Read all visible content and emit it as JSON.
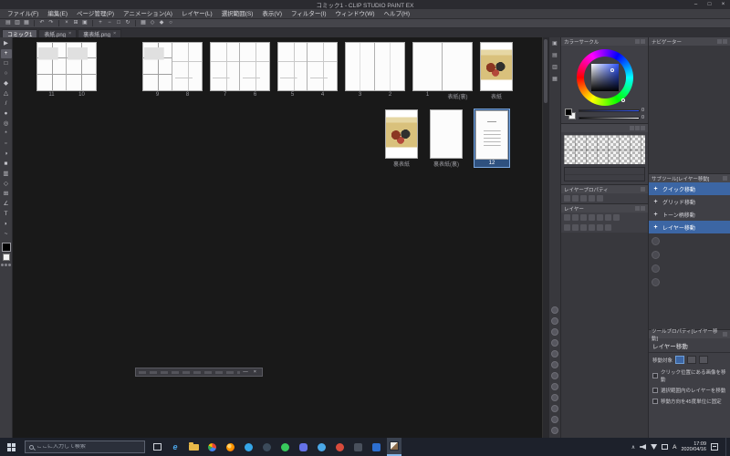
{
  "window": {
    "title": "コミック1 - CLIP STUDIO PAINT EX",
    "minimize": "–",
    "maximize": "□",
    "close": "×"
  },
  "menu": {
    "items": [
      "ファイル(F)",
      "編集(E)",
      "ページ管理(P)",
      "アニメーション(A)",
      "レイヤー(L)",
      "選択範囲(S)",
      "表示(V)",
      "フィルター(I)",
      "ウィンドウ(W)",
      "ヘルプ(H)"
    ]
  },
  "command_bar": {
    "icons": [
      {
        "name": "new-icon",
        "glyph": "▤"
      },
      {
        "name": "open-icon",
        "glyph": "▥"
      },
      {
        "name": "save-icon",
        "glyph": "▦"
      },
      {
        "name": "undo-icon",
        "glyph": "↶"
      },
      {
        "name": "redo-icon",
        "glyph": "↷"
      },
      {
        "name": "cut-icon",
        "glyph": "×"
      },
      {
        "name": "copy-icon",
        "glyph": "⊞"
      },
      {
        "name": "paste-icon",
        "glyph": "▣"
      },
      {
        "name": "zoom-in-icon",
        "glyph": "+"
      },
      {
        "name": "zoom-out-icon",
        "glyph": "−"
      },
      {
        "name": "fit-view-icon",
        "glyph": "□"
      },
      {
        "name": "rotate-view-icon",
        "glyph": "↻"
      },
      {
        "name": "grid-icon",
        "glyph": "▦"
      },
      {
        "name": "snap-ruler-icon",
        "glyph": "◇"
      },
      {
        "name": "snap-special-icon",
        "glyph": "◆"
      },
      {
        "name": "snap-off-icon",
        "glyph": "○"
      }
    ]
  },
  "tabs": {
    "items": [
      {
        "label": "コミック1"
      },
      {
        "label": "表紙.png",
        "close": "×"
      },
      {
        "label": "裏表紙.png",
        "close": "×"
      }
    ]
  },
  "tool_palette": {
    "tools": [
      {
        "name": "operation-tool",
        "glyph": "▶"
      },
      {
        "name": "layer-move-tool",
        "glyph": "+"
      },
      {
        "name": "selection-tool",
        "glyph": "□"
      },
      {
        "name": "auto-select-tool",
        "glyph": "○"
      },
      {
        "name": "eyedropper-tool",
        "glyph": "◆"
      },
      {
        "name": "pen-tool",
        "glyph": "△"
      },
      {
        "name": "pencil-tool",
        "glyph": "/"
      },
      {
        "name": "brush-tool",
        "glyph": "●"
      },
      {
        "name": "airbrush-tool",
        "glyph": "◎"
      },
      {
        "name": "decoration-tool",
        "glyph": "*"
      },
      {
        "name": "eraser-tool",
        "glyph": "▫"
      },
      {
        "name": "blend-tool",
        "glyph": "◑"
      },
      {
        "name": "fill-tool",
        "glyph": "■"
      },
      {
        "name": "gradient-tool",
        "glyph": "▥"
      },
      {
        "name": "figure-tool",
        "glyph": "◇"
      },
      {
        "name": "frame-border-tool",
        "glyph": "⊞"
      },
      {
        "name": "ruler-tool",
        "glyph": "∠"
      },
      {
        "name": "text-tool",
        "glyph": "T"
      },
      {
        "name": "balloon-tool",
        "glyph": "◗"
      },
      {
        "name": "correction-tool",
        "glyph": "~"
      }
    ]
  },
  "page_manager": {
    "row1": [
      {
        "left": {
          "label": "11"
        },
        "right": {
          "label": "10"
        }
      },
      {
        "left": {
          "label": "9"
        },
        "right": {
          "label": "8"
        }
      },
      {
        "left": {
          "label": "7"
        },
        "right": {
          "label": "6"
        }
      },
      {
        "left": {
          "label": "5"
        },
        "right": {
          "label": "4"
        }
      },
      {
        "left": {
          "label": "3"
        },
        "right": {
          "label": "2"
        }
      },
      {
        "left": {
          "label": "1"
        },
        "right": {
          "label": "表紙(裏)"
        }
      }
    ],
    "front_cover": {
      "label": "表紙"
    },
    "row2": [
      {
        "label": "裏表紙"
      },
      {
        "label": "裏表紙(裏)"
      },
      {
        "label": "12",
        "selected": true
      }
    ]
  },
  "floating_bar": {
    "minimize": "—",
    "close": "×"
  },
  "palette_dock": {
    "icons": [
      {
        "name": "quick-access-palette-icon",
        "glyph": "▣"
      },
      {
        "name": "material-palette-icon",
        "glyph": "▤"
      },
      {
        "name": "history-palette-icon",
        "glyph": "▥"
      },
      {
        "name": "information-palette-icon",
        "glyph": "▦"
      }
    ]
  },
  "panels": {
    "color_circle": {
      "title": "カラーサークル",
      "hue_value": "0",
      "sv_value": "0"
    },
    "layer_property": {
      "title": "レイヤープロパティ"
    },
    "layer": {
      "title": "レイヤー"
    },
    "navigator": {
      "title": "ナビゲーター"
    },
    "sub_tool": {
      "title": "サブツール[レイヤー移動]",
      "icon_glyph": "+",
      "items": [
        {
          "label": "クイック移動",
          "selected": true
        },
        {
          "label": "グリッド移動",
          "selected": false
        },
        {
          "label": "トーン柄移動",
          "selected": false
        },
        {
          "label": "レイヤー移動",
          "selected": true
        }
      ]
    },
    "tool_property": {
      "title": "ツールプロパティ[レイヤー移動]",
      "tool_name": "レイヤー移動",
      "target_label": "移動対象",
      "options": [
        {
          "label": "クリック位置にある画像を移動",
          "checked": false
        },
        {
          "label": "選択範囲内のレイヤーを移動",
          "checked": false
        },
        {
          "label": "移動方向を45度単位に固定",
          "checked": false
        }
      ]
    }
  },
  "taskbar": {
    "search": {
      "placeholder": "ここに入力して検索"
    },
    "apps": [
      {
        "name": "task-view"
      },
      {
        "name": "edge",
        "glyph": "e"
      },
      {
        "name": "file-explorer"
      },
      {
        "name": "chrome"
      },
      {
        "name": "firefox"
      },
      {
        "name": "skype"
      },
      {
        "name": "steam"
      },
      {
        "name": "line"
      },
      {
        "name": "discord"
      },
      {
        "name": "twitter"
      },
      {
        "name": "media-player"
      },
      {
        "name": "dark-app"
      },
      {
        "name": "blue-app"
      },
      {
        "name": "clip-studio-paint",
        "active": true
      }
    ],
    "tray": {
      "chevron": "∧",
      "ime": "A",
      "time": "17:09",
      "date": "2020/04/16"
    }
  }
}
